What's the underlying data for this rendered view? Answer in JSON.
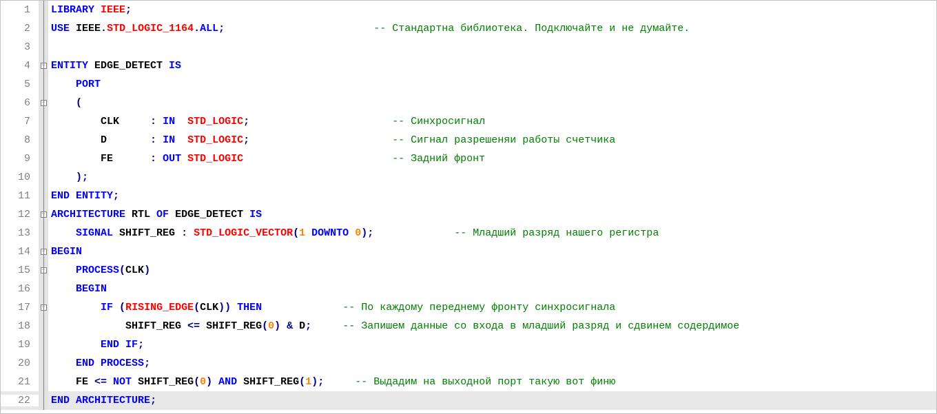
{
  "lines": [
    {
      "num": 1,
      "fold": "line",
      "highlight": false,
      "tokens": [
        {
          "t": "LIBRARY",
          "c": "kw"
        },
        {
          "t": " ",
          "c": "ident"
        },
        {
          "t": "IEEE",
          "c": "type"
        },
        {
          "t": ";",
          "c": "punc"
        }
      ]
    },
    {
      "num": 2,
      "fold": "line",
      "highlight": false,
      "tokens": [
        {
          "t": "USE",
          "c": "kw"
        },
        {
          "t": " ",
          "c": "ident"
        },
        {
          "t": "IEEE",
          "c": "ident"
        },
        {
          "t": ".",
          "c": "punc"
        },
        {
          "t": "STD_LOGIC_1164",
          "c": "type"
        },
        {
          "t": ".",
          "c": "punc"
        },
        {
          "t": "ALL",
          "c": "kw"
        },
        {
          "t": ";",
          "c": "punc"
        },
        {
          "t": "                        ",
          "c": "ident"
        },
        {
          "t": "-- Стандартна библиотека. Подключайте и не думайте.",
          "c": "comment"
        }
      ]
    },
    {
      "num": 3,
      "fold": "line",
      "highlight": false,
      "tokens": []
    },
    {
      "num": 4,
      "fold": "box",
      "highlight": false,
      "tokens": [
        {
          "t": "ENTITY",
          "c": "kw"
        },
        {
          "t": " EDGE_DETECT ",
          "c": "ident"
        },
        {
          "t": "IS",
          "c": "kw"
        }
      ]
    },
    {
      "num": 5,
      "fold": "line",
      "highlight": false,
      "tokens": [
        {
          "t": "    ",
          "c": "ident"
        },
        {
          "t": "PORT",
          "c": "kw"
        }
      ]
    },
    {
      "num": 6,
      "fold": "box",
      "highlight": false,
      "tokens": [
        {
          "t": "    ",
          "c": "ident"
        },
        {
          "t": "(",
          "c": "punc"
        }
      ]
    },
    {
      "num": 7,
      "fold": "line",
      "highlight": false,
      "tokens": [
        {
          "t": "        CLK     ",
          "c": "ident"
        },
        {
          "t": ":",
          "c": "punc"
        },
        {
          "t": " ",
          "c": "ident"
        },
        {
          "t": "IN",
          "c": "kw"
        },
        {
          "t": "  ",
          "c": "ident"
        },
        {
          "t": "STD_LOGIC",
          "c": "type"
        },
        {
          "t": ";",
          "c": "punc"
        },
        {
          "t": "                       ",
          "c": "ident"
        },
        {
          "t": "-- Синхросигнал",
          "c": "comment"
        }
      ]
    },
    {
      "num": 8,
      "fold": "line",
      "highlight": false,
      "tokens": [
        {
          "t": "        D       ",
          "c": "ident"
        },
        {
          "t": ":",
          "c": "punc"
        },
        {
          "t": " ",
          "c": "ident"
        },
        {
          "t": "IN",
          "c": "kw"
        },
        {
          "t": "  ",
          "c": "ident"
        },
        {
          "t": "STD_LOGIC",
          "c": "type"
        },
        {
          "t": ";",
          "c": "punc"
        },
        {
          "t": "                       ",
          "c": "ident"
        },
        {
          "t": "-- Сигнал разрешеняи работы счетчика",
          "c": "comment"
        }
      ]
    },
    {
      "num": 9,
      "fold": "line",
      "highlight": false,
      "tokens": [
        {
          "t": "        FE      ",
          "c": "ident"
        },
        {
          "t": ":",
          "c": "punc"
        },
        {
          "t": " ",
          "c": "ident"
        },
        {
          "t": "OUT",
          "c": "kw"
        },
        {
          "t": " ",
          "c": "ident"
        },
        {
          "t": "STD_LOGIC",
          "c": "type"
        },
        {
          "t": "                        ",
          "c": "ident"
        },
        {
          "t": "-- Задний фронт",
          "c": "comment"
        }
      ]
    },
    {
      "num": 10,
      "fold": "line",
      "highlight": false,
      "tokens": [
        {
          "t": "    ",
          "c": "ident"
        },
        {
          "t": ");",
          "c": "punc"
        }
      ]
    },
    {
      "num": 11,
      "fold": "line",
      "highlight": false,
      "tokens": [
        {
          "t": "END",
          "c": "kw"
        },
        {
          "t": " ",
          "c": "ident"
        },
        {
          "t": "ENTITY",
          "c": "kw"
        },
        {
          "t": ";",
          "c": "punc"
        }
      ]
    },
    {
      "num": 12,
      "fold": "box",
      "highlight": false,
      "tokens": [
        {
          "t": "ARCHITECTURE",
          "c": "kw"
        },
        {
          "t": " RTL ",
          "c": "ident"
        },
        {
          "t": "OF",
          "c": "kw"
        },
        {
          "t": " EDGE_DETECT ",
          "c": "ident"
        },
        {
          "t": "IS",
          "c": "kw"
        }
      ]
    },
    {
      "num": 13,
      "fold": "line",
      "highlight": false,
      "tokens": [
        {
          "t": "    ",
          "c": "ident"
        },
        {
          "t": "SIGNAL",
          "c": "kw"
        },
        {
          "t": " SHIFT_REG ",
          "c": "ident"
        },
        {
          "t": ":",
          "c": "punc"
        },
        {
          "t": " ",
          "c": "ident"
        },
        {
          "t": "STD_LOGIC_VECTOR",
          "c": "type"
        },
        {
          "t": "(",
          "c": "punc"
        },
        {
          "t": "1",
          "c": "num"
        },
        {
          "t": " ",
          "c": "ident"
        },
        {
          "t": "DOWNTO",
          "c": "kw"
        },
        {
          "t": " ",
          "c": "ident"
        },
        {
          "t": "0",
          "c": "num"
        },
        {
          "t": ");",
          "c": "punc"
        },
        {
          "t": "             ",
          "c": "ident"
        },
        {
          "t": "-- Младший разряд нашего регистра",
          "c": "comment"
        }
      ]
    },
    {
      "num": 14,
      "fold": "box",
      "highlight": false,
      "tokens": [
        {
          "t": "BEGIN",
          "c": "kw"
        }
      ]
    },
    {
      "num": 15,
      "fold": "box",
      "highlight": false,
      "tokens": [
        {
          "t": "    ",
          "c": "ident"
        },
        {
          "t": "PROCESS",
          "c": "kw"
        },
        {
          "t": "(",
          "c": "punc"
        },
        {
          "t": "CLK",
          "c": "ident"
        },
        {
          "t": ")",
          "c": "punc"
        }
      ]
    },
    {
      "num": 16,
      "fold": "line",
      "highlight": false,
      "tokens": [
        {
          "t": "    ",
          "c": "ident"
        },
        {
          "t": "BEGIN",
          "c": "kw"
        }
      ]
    },
    {
      "num": 17,
      "fold": "box",
      "highlight": false,
      "tokens": [
        {
          "t": "        ",
          "c": "ident"
        },
        {
          "t": "IF",
          "c": "kw"
        },
        {
          "t": " ",
          "c": "ident"
        },
        {
          "t": "(",
          "c": "punc"
        },
        {
          "t": "RISING_EDGE",
          "c": "type"
        },
        {
          "t": "(",
          "c": "punc"
        },
        {
          "t": "CLK",
          "c": "ident"
        },
        {
          "t": "))",
          "c": "punc"
        },
        {
          "t": " ",
          "c": "ident"
        },
        {
          "t": "THEN",
          "c": "kw"
        },
        {
          "t": "             ",
          "c": "ident"
        },
        {
          "t": "-- По каждому переднему фронту синхросигнала",
          "c": "comment"
        }
      ]
    },
    {
      "num": 18,
      "fold": "line",
      "highlight": false,
      "tokens": [
        {
          "t": "            SHIFT_REG ",
          "c": "ident"
        },
        {
          "t": "<=",
          "c": "punc"
        },
        {
          "t": " SHIFT_REG",
          "c": "ident"
        },
        {
          "t": "(",
          "c": "punc"
        },
        {
          "t": "0",
          "c": "num"
        },
        {
          "t": ")",
          "c": "punc"
        },
        {
          "t": " ",
          "c": "ident"
        },
        {
          "t": "&",
          "c": "punc"
        },
        {
          "t": " D",
          "c": "ident"
        },
        {
          "t": ";",
          "c": "punc"
        },
        {
          "t": "     ",
          "c": "ident"
        },
        {
          "t": "-- Запишем данные со входа в младший разряд и сдвинем содердимое",
          "c": "comment"
        }
      ]
    },
    {
      "num": 19,
      "fold": "line",
      "highlight": false,
      "tokens": [
        {
          "t": "        ",
          "c": "ident"
        },
        {
          "t": "END",
          "c": "kw"
        },
        {
          "t": " ",
          "c": "ident"
        },
        {
          "t": "IF",
          "c": "kw"
        },
        {
          "t": ";",
          "c": "punc"
        }
      ]
    },
    {
      "num": 20,
      "fold": "line",
      "highlight": false,
      "tokens": [
        {
          "t": "    ",
          "c": "ident"
        },
        {
          "t": "END",
          "c": "kw"
        },
        {
          "t": " ",
          "c": "ident"
        },
        {
          "t": "PROCESS",
          "c": "kw"
        },
        {
          "t": ";",
          "c": "punc"
        }
      ]
    },
    {
      "num": 21,
      "fold": "line",
      "highlight": false,
      "tokens": [
        {
          "t": "    FE ",
          "c": "ident"
        },
        {
          "t": "<=",
          "c": "punc"
        },
        {
          "t": " ",
          "c": "ident"
        },
        {
          "t": "NOT",
          "c": "kw"
        },
        {
          "t": " SHIFT_REG",
          "c": "ident"
        },
        {
          "t": "(",
          "c": "punc"
        },
        {
          "t": "0",
          "c": "num"
        },
        {
          "t": ")",
          "c": "punc"
        },
        {
          "t": " ",
          "c": "ident"
        },
        {
          "t": "AND",
          "c": "kw"
        },
        {
          "t": " SHIFT_REG",
          "c": "ident"
        },
        {
          "t": "(",
          "c": "punc"
        },
        {
          "t": "1",
          "c": "num"
        },
        {
          "t": ");",
          "c": "punc"
        },
        {
          "t": "     ",
          "c": "ident"
        },
        {
          "t": "-- Выдадим на выходной порт такую вот финю",
          "c": "comment"
        }
      ]
    },
    {
      "num": 22,
      "fold": "line",
      "highlight": true,
      "tokens": [
        {
          "t": "END",
          "c": "kw"
        },
        {
          "t": " ",
          "c": "ident"
        },
        {
          "t": "ARCHITECTURE",
          "c": "kw"
        },
        {
          "t": ";",
          "c": "punc"
        }
      ]
    }
  ]
}
